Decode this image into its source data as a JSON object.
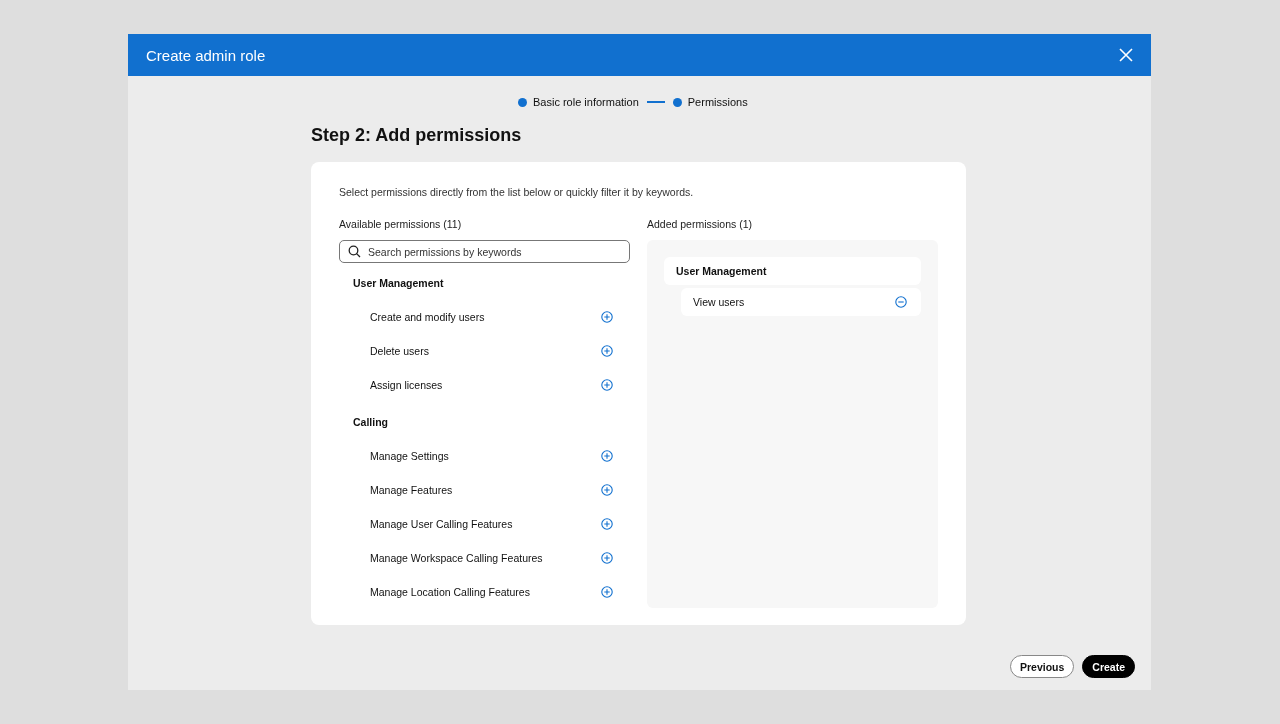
{
  "window": {
    "title": "Create admin role"
  },
  "steps": [
    {
      "label": "Basic role information"
    },
    {
      "label": "Permissions"
    }
  ],
  "heading": "Step 2: Add permissions",
  "intro": "Select permissions directly from the list below or quickly filter it by keywords.",
  "available": {
    "title": "Available permissions (11)",
    "search": {
      "placeholder": "Search permissions by keywords"
    },
    "groups": [
      {
        "name": "User Management",
        "items": [
          "Create and modify users",
          "Delete users",
          "Assign licenses"
        ]
      },
      {
        "name": "Calling",
        "items": [
          "Manage Settings",
          "Manage Features",
          "Manage User Calling Features",
          "Manage Workspace Calling Features",
          "Manage Location Calling Features"
        ]
      }
    ]
  },
  "added": {
    "title": "Added permissions (1)",
    "groups": [
      {
        "name": "User Management",
        "items": [
          "View users"
        ]
      }
    ]
  },
  "buttons": [
    {
      "label": "Previous",
      "kind": "secondary"
    },
    {
      "label": "Create",
      "kind": "primary"
    }
  ]
}
